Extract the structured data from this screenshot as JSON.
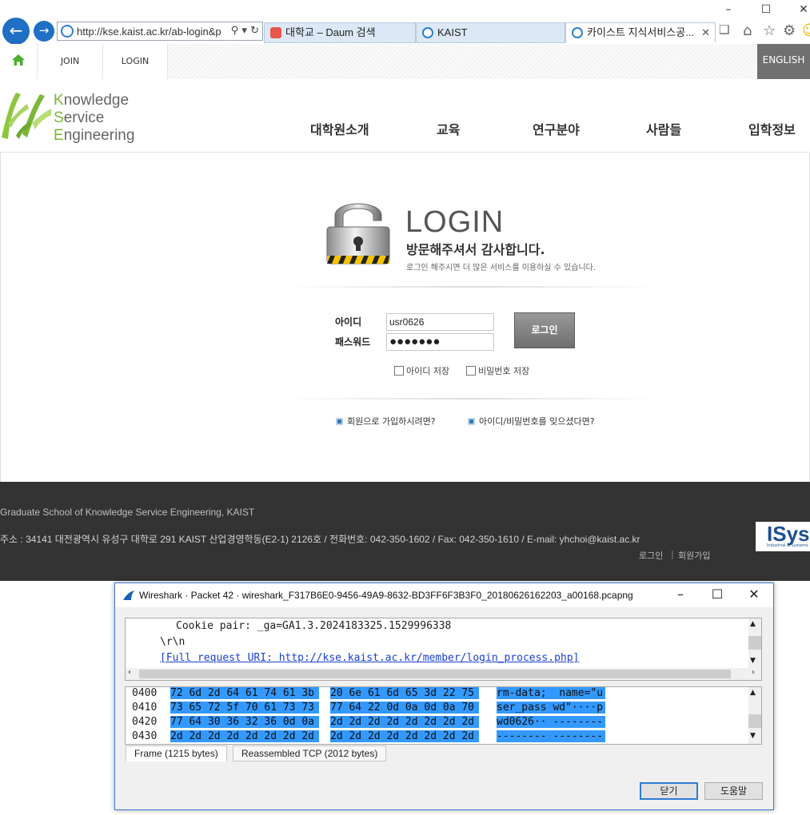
{
  "browser": {
    "url": "http://kse.kaist.ac.kr/ab-login&pr",
    "tabs": [
      {
        "label": "대학교 – Daum 검색",
        "favicon_color": "#e8574a"
      },
      {
        "label": "KAIST",
        "favicon_color": "#2a7fd4"
      },
      {
        "label": "카이스트 지식서비스공...",
        "favicon_color": "#2a7fd4",
        "active": true
      }
    ],
    "window_controls": [
      "–",
      "☐",
      "✕"
    ]
  },
  "topbar": {
    "join": "JOIN",
    "login": "LOGIN",
    "english": "ENGLISH"
  },
  "header": {
    "logo_lines": [
      {
        "initial": "K",
        "rest": "nowledge"
      },
      {
        "initial": "S",
        "rest": "ervice"
      },
      {
        "initial": "E",
        "rest": "ngineering"
      }
    ],
    "menu": [
      "대학원소개",
      "교육",
      "연구분야",
      "사람들",
      "입학정보"
    ]
  },
  "login": {
    "title": "LOGIN",
    "subtitle": "방문해주셔서 감사합니다.",
    "description": "로그인 해주시면 더 많은 서비스를 이용하실 수 있습니다.",
    "id_label": "아이디",
    "pw_label": "패스워드",
    "id_value": "usr0626",
    "pw_value": "●●●●●●●",
    "button": "로그인",
    "save_id": "아이디 저장",
    "save_pw": "비밀번호 저장",
    "join_help": "회원으로 가입하시려면?",
    "forgot_help": "아이디/비밀번호를 잊으셨다면?"
  },
  "footer": {
    "school": "Graduate School of Knowledge Service Engineering, KAIST",
    "address": "주소 : 34141 대전광역시 유성구 대학로 291 KAIST 산업경영학동(E2-1) 2126호 / 전화번호: 042-350-1602 / Fax: 042-350-1610 / E-mail: yhchoi@kaist.ac.kr",
    "login_link": "로그인",
    "join_link": "회원가입",
    "partner_logo": "ISys",
    "partner_tagline": "Industrial & Systems"
  },
  "wireshark": {
    "title": "Wireshark · Packet 42 · wireshark_F317B6E0-9456-49A9-8632-BD3FF6F3B3F0_20180626162203_a00168.pcapng",
    "detail_lines": [
      "Cookie pair: _ga=GA1.3.2024183325.1529996338",
      "\\r\\n",
      "[Full request URI: http://kse.kaist.ac.kr/member/login_process.php]"
    ],
    "hex_rows": [
      {
        "offset": "0400",
        "bytes1": "72 6d 2d 64 61 74 61 3b",
        "bytes2": "20 6e 61 6d 65 3d 22 75",
        "ascii": "rm-data;  name=\"u"
      },
      {
        "offset": "0410",
        "bytes1": "73 65 72 5f 70 61 73 73",
        "bytes2": "77 64 22 0d 0a 0d 0a 70",
        "ascii": "ser_pass wd\"····p"
      },
      {
        "offset": "0420",
        "bytes1": "77 64 30 36 32 36 0d 0a",
        "bytes2": "2d 2d 2d 2d 2d 2d 2d 2d",
        "ascii": "wd0626·· --------"
      },
      {
        "offset": "0430",
        "bytes1": "2d 2d 2d 2d 2d 2d 2d 2d",
        "bytes2": "2d 2d 2d 2d 2d 2d 2d 2d",
        "ascii": "-------- --------"
      }
    ],
    "tab_frame": "Frame (1215 bytes)",
    "tab_reassembled": "Reassembled TCP (2012 bytes)",
    "close_button": "닫기",
    "help_button": "도움말"
  }
}
